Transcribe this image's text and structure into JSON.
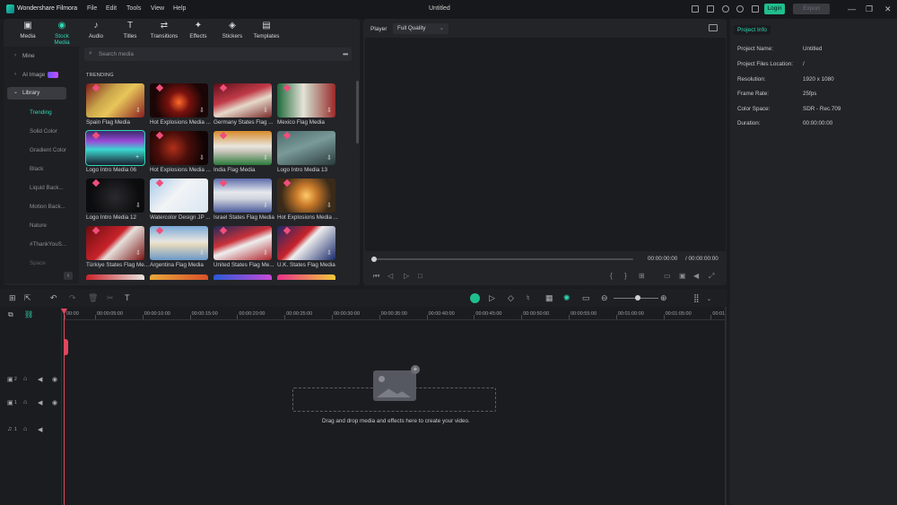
{
  "titlebar": {
    "app_name": "Wondershare Filmora",
    "menu": [
      "File",
      "Edit",
      "Tools",
      "View",
      "Help"
    ],
    "title": "Untitled",
    "login": "Login",
    "export": "Export"
  },
  "tabs": [
    {
      "label": "Media",
      "icon": "media-icon"
    },
    {
      "label": "Stock Media",
      "icon": "stock-media-icon"
    },
    {
      "label": "Audio",
      "icon": "audio-icon"
    },
    {
      "label": "Titles",
      "icon": "titles-icon"
    },
    {
      "label": "Transitions",
      "icon": "transitions-icon"
    },
    {
      "label": "Effects",
      "icon": "effects-icon"
    },
    {
      "label": "Stickers",
      "icon": "stickers-icon"
    },
    {
      "label": "Templates",
      "icon": "templates-icon"
    }
  ],
  "sidebar": {
    "mine": "Mine",
    "ai_image": "AI Image",
    "library": "Library",
    "sub": [
      "Trending",
      "Solid Color",
      "Gradient Color",
      "Black",
      "Liquid Back...",
      "Motion Back...",
      "Nature",
      "#ThankYouS...",
      "Space"
    ]
  },
  "search": {
    "placeholder": "Search media"
  },
  "section": "TRENDING",
  "media": [
    "Spain Flag Media",
    "Hot Explosions Media ...",
    "Germany States Flag ...",
    "Mexico Flag Media",
    "Logo Intro Media 06",
    "Hot Explosions Media ...",
    "India Flag Media",
    "Logo Intro Media 13",
    "Logo Intro Media 12",
    "Watercolor Design JP ...",
    "Israel States Flag Media",
    "Hot Explosions Media ...",
    "Türkiye States Flag Me...",
    "Argentina Flag Media",
    "United States Flag Me...",
    "U.K. States Flag Media"
  ],
  "player": {
    "label": "Player",
    "quality": "Full Quality",
    "current": "00:00:00:00",
    "total": "/ 00:00:00:00"
  },
  "project": {
    "tab": "Project Info",
    "rows": [
      [
        "Project Name:",
        "Untitled"
      ],
      [
        "Project Files Location:",
        "/"
      ],
      [
        "Resolution:",
        "1920 x 1080"
      ],
      [
        "Frame Rate:",
        "25fps"
      ],
      [
        "Color Space:",
        "SDR - Rec.709"
      ],
      [
        "Duration:",
        "00:00:00:00"
      ]
    ]
  },
  "ruler": [
    "00:00",
    "00:00:05:00",
    "00:00:10:00",
    "00:00:15:00",
    "00:00:20:00",
    "00:00:25:00",
    "00:00:30:00",
    "00:00:35:00",
    "00:00:40:00",
    "00:00:45:00",
    "00:00:50:00",
    "00:00:55:00",
    "00:01:00:00",
    "00:01:05:00",
    "00:01"
  ],
  "tracks": [
    "2",
    "1",
    "1"
  ],
  "drop_text": "Drag and drop media and effects here to create your video.",
  "colors": {
    "accent": "#2fd8b4",
    "playhead": "#e0475e",
    "login": "#1fbf8f"
  }
}
